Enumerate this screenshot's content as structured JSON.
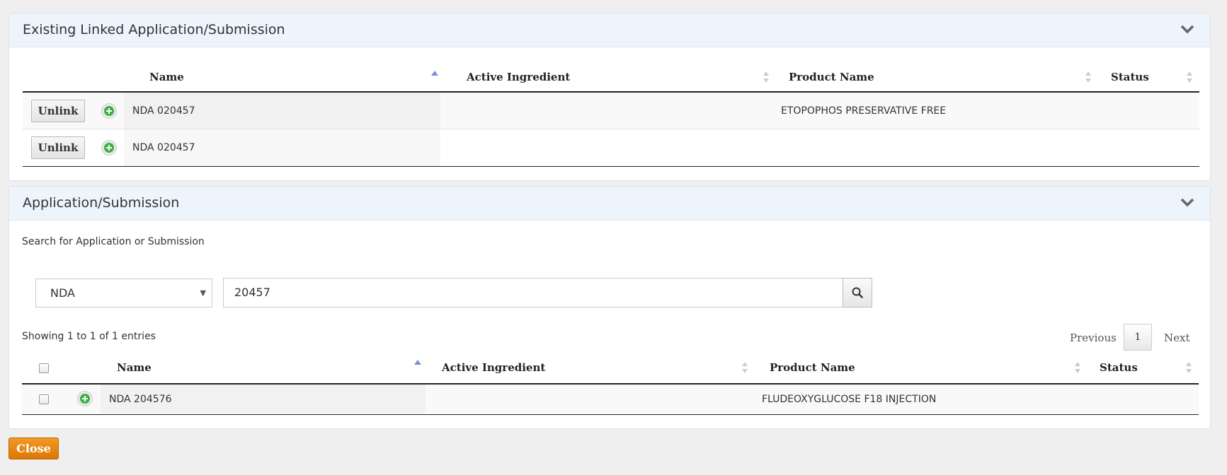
{
  "linked_panel": {
    "title": "Existing Linked Application/Submission",
    "columns": [
      "Name",
      "Active Ingredient",
      "Product Name",
      "Status"
    ],
    "rows": [
      {
        "action": "Unlink",
        "name": "NDA 020457",
        "active_ingredient": "",
        "product_name": "ETOPOPHOS PRESERVATIVE FREE",
        "status": ""
      },
      {
        "action": "Unlink",
        "name": "NDA 020457",
        "active_ingredient": "",
        "product_name": "",
        "status": ""
      }
    ]
  },
  "search_panel": {
    "title": "Application/Submission",
    "search_label": "Search for Application or Submission",
    "type_select": "NDA",
    "search_value": "20457",
    "info": "Showing 1 to 1 of 1 entries",
    "pagination": {
      "previous": "Previous",
      "page": "1",
      "next": "Next"
    },
    "columns": [
      "Name",
      "Active Ingredient",
      "Product Name",
      "Status"
    ],
    "rows": [
      {
        "name": "NDA 204576",
        "active_ingredient": "",
        "product_name": "FLUDEOXYGLUCOSE F18 INJECTION",
        "status": ""
      }
    ]
  },
  "close_label": "Close",
  "colors": {
    "accent": "#e58a14",
    "header_bg": "#edf4fb",
    "plus_icon": "#3cb043"
  },
  "icons": [
    "chevron-down-icon",
    "plus-circle-icon",
    "search-icon",
    "sort-icon"
  ]
}
